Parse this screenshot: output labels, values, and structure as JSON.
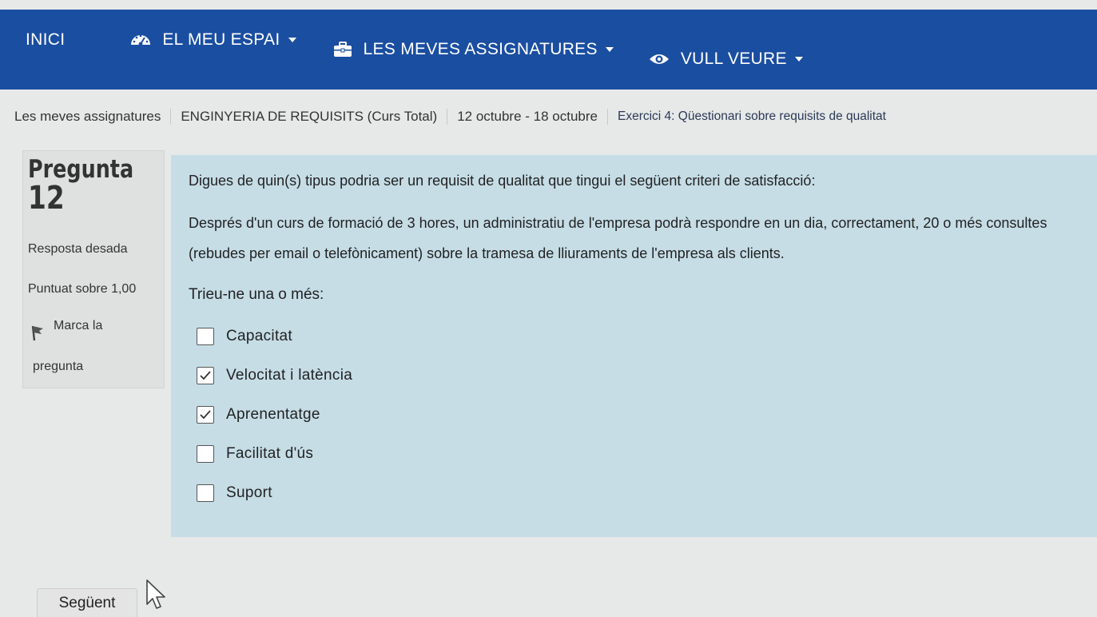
{
  "navbar": {
    "home": "INICI",
    "my_space": "EL MEU ESPAI",
    "my_courses": "LES MEVES ASSIGNATURES",
    "want_to_see": "VULL VEURE",
    "icons": {
      "my_space": "dashboard-icon",
      "my_courses": "briefcase-icon",
      "want_to_see": "eye-icon"
    }
  },
  "breadcrumb": [
    "Les meves assignatures",
    "ENGINYERIA DE REQUISITS (Curs Total)",
    "12 octubre - 18 octubre",
    "Exercici 4: Qüestionari sobre requisits de qualitat"
  ],
  "question_info": {
    "word": "Pregunta",
    "number": "12",
    "state": "Resposta desada",
    "grade": "Puntuat sobre 1,00",
    "flag_line1": "Marca la",
    "flag_line2": "pregunta"
  },
  "question": {
    "text_1": "Digues de quin(s) tipus podria ser un requisit de qualitat que tingui el següent criteri de satisfacció:",
    "text_2": "Després d'un curs de formació de 3 hores, un administratiu de l'empresa podrà respondre en un dia, correctament, 20 o més consultes (rebudes per email o telefònicament) sobre la tramesa de lliuraments de l'empresa als clients.",
    "prompt": "Trieu-ne una o més:",
    "answers": [
      {
        "label": "Capacitat",
        "checked": false
      },
      {
        "label": "Velocitat i latència",
        "checked": true
      },
      {
        "label": "Aprenentatge",
        "checked": true
      },
      {
        "label": "Facilitat d'ús",
        "checked": false
      },
      {
        "label": "Suport",
        "checked": false
      }
    ]
  },
  "next_button": "Següent",
  "colors": {
    "navbar": "#1a4ea1",
    "content_bg": "#c6dde6",
    "info_bg": "#dfe1e1",
    "page_bg": "#e7e9e9"
  }
}
